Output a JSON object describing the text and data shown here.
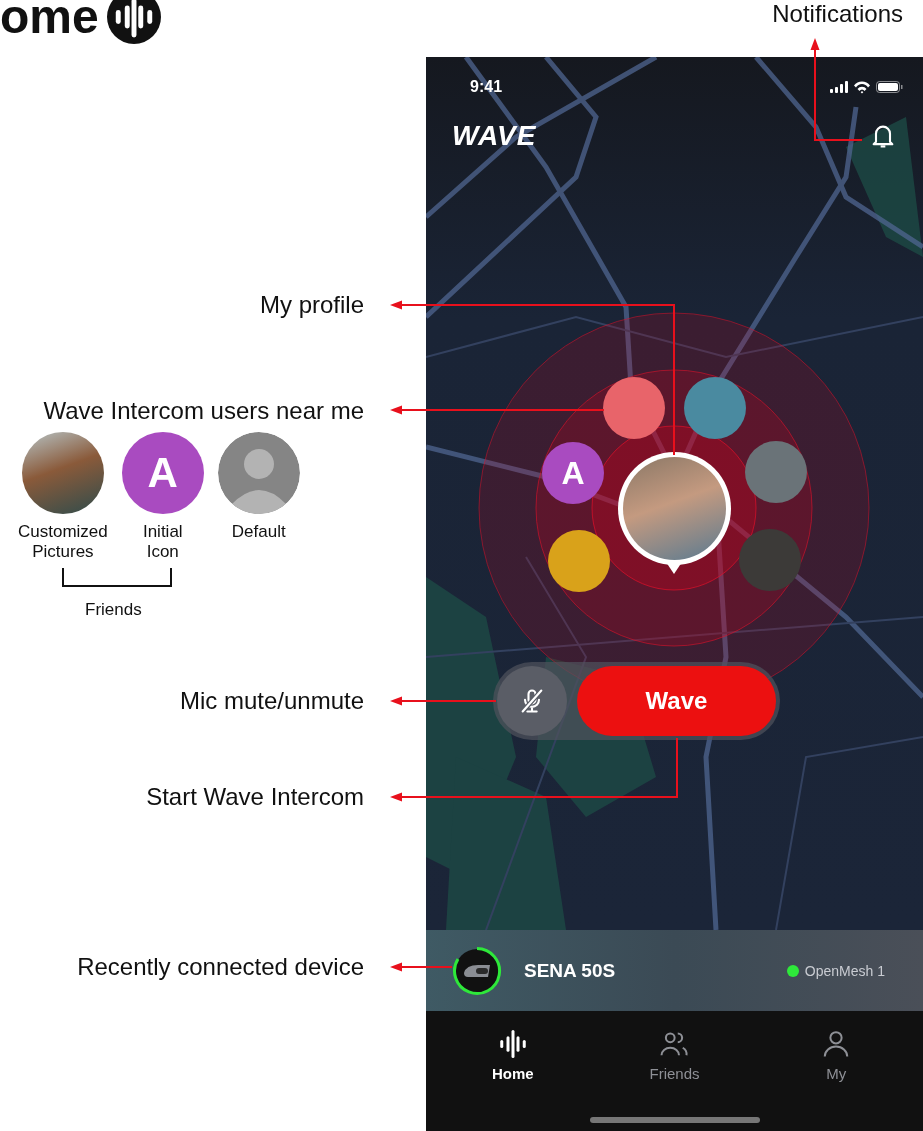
{
  "page": {
    "title": "ome"
  },
  "annotations": [
    {
      "kind": "notifications",
      "text": "Notifications"
    },
    {
      "kind": "profile",
      "text": "My profile"
    },
    {
      "kind": "users",
      "text": "Wave Intercom users near me"
    },
    {
      "kind": "mic",
      "text": "Mic mute/unmute"
    },
    {
      "kind": "start",
      "text": "Start Wave Intercom"
    },
    {
      "kind": "device",
      "text": "Recently connected device"
    }
  ],
  "legend": {
    "items": [
      {
        "kind": "photo",
        "label": "Customized Pictures"
      },
      {
        "kind": "initial",
        "initial": "A",
        "color": "#a94bc0",
        "label": "Initial Icon"
      },
      {
        "kind": "default",
        "label": "Default"
      }
    ],
    "group_label": "Friends"
  },
  "phone": {
    "status_bar": {
      "time": "9:41"
    },
    "logo": "WAVE",
    "users": [
      {
        "kind": "photo"
      },
      {
        "kind": "photo"
      },
      {
        "kind": "initial",
        "initial": "A",
        "color": "#a94bc0"
      },
      {
        "kind": "photo"
      },
      {
        "kind": "photo"
      },
      {
        "kind": "photo"
      }
    ],
    "controls": {
      "mic_muted": true,
      "action": "Wave"
    },
    "device": {
      "name": "SENA 50S",
      "channel": "OpenMesh 1",
      "status_dot": {
        "color": "#2ee83a"
      }
    },
    "tabs": [
      {
        "label": "Home",
        "selected": true
      },
      {
        "label": "Friends",
        "selected": false
      },
      {
        "label": "My",
        "selected": false
      }
    ]
  }
}
